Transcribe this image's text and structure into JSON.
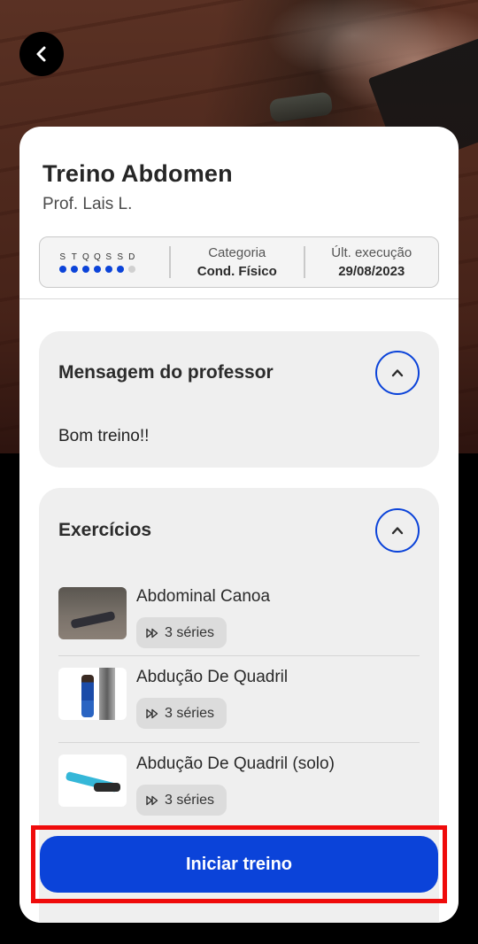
{
  "nav": {
    "back_icon": "chevron-left-icon"
  },
  "workout": {
    "title": "Treino Abdomen",
    "trainer": "Prof. Lais L.",
    "days": {
      "letters": [
        "S",
        "T",
        "Q",
        "Q",
        "S",
        "S",
        "D"
      ],
      "active": [
        true,
        true,
        true,
        true,
        true,
        true,
        false
      ]
    },
    "category_label": "Categoria",
    "category_value": "Cond. Físico",
    "last_exec_label": "Últ. execução",
    "last_exec_value": "29/08/2023"
  },
  "message_section": {
    "title": "Mensagem do professor",
    "text": "Bom treino!!",
    "toggle_icon": "chevron-up-icon"
  },
  "exercises_section": {
    "title": "Exercícios",
    "toggle_icon": "chevron-up-icon",
    "items": [
      {
        "name": "Abdominal Canoa",
        "series": "3 séries"
      },
      {
        "name": "Abdução De Quadril",
        "series": "3 séries"
      },
      {
        "name": "Abdução De Quadril (solo)",
        "series": "3 séries"
      }
    ]
  },
  "actions": {
    "start_label": "Iniciar treino"
  },
  "colors": {
    "accent": "#0b43d9",
    "highlight": "#ef0b0b",
    "inactive_dot": "#d0d0d0"
  }
}
